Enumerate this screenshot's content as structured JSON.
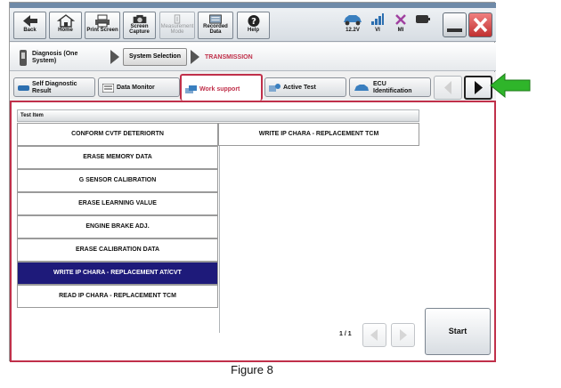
{
  "toolbar": {
    "back": "Back",
    "home": "Home",
    "print": "Print Screen",
    "capture_1": "Screen",
    "capture_2": "Capture",
    "measurement_1": "Measurement",
    "measurement_2": "Mode",
    "recorded_1": "Recorded",
    "recorded_2": "Data",
    "help": "Help",
    "voltage": "12.2V",
    "vi": "VI",
    "mi": "MI"
  },
  "breadcrumb": {
    "item1_line1": "Diagnosis (One",
    "item1_line2": "System)",
    "item2": "System Selection",
    "item3": "TRANSMISSION"
  },
  "tabs": {
    "self_diag_1": "Self Diagnostic",
    "self_diag_2": "Result",
    "data_monitor": "Data Monitor",
    "work_support": "Work support",
    "active_test": "Active Test",
    "ecu_1": "ECU",
    "ecu_2": "Identification"
  },
  "list": {
    "header": "Test Item",
    "col1": [
      "CONFORM CVTF DETERIORTN",
      "ERASE MEMORY DATA",
      "G SENSOR CALIBRATION",
      "ERASE LEARNING VALUE",
      "ENGINE BRAKE ADJ.",
      "ERASE CALIBRATION DATA",
      "WRITE IP CHARA - REPLACEMENT AT/CVT",
      "READ IP CHARA - REPLACEMENT TCM"
    ],
    "col2": [
      "WRITE IP CHARA - REPLACEMENT TCM"
    ],
    "selected_index": 6
  },
  "pager": {
    "text": "1 / 1"
  },
  "start_label": "Start",
  "caption": "Figure 8",
  "colors": {
    "accent": "#c0304a",
    "selected": "#1e1a7a",
    "green_arrow": "#2fb52a"
  }
}
